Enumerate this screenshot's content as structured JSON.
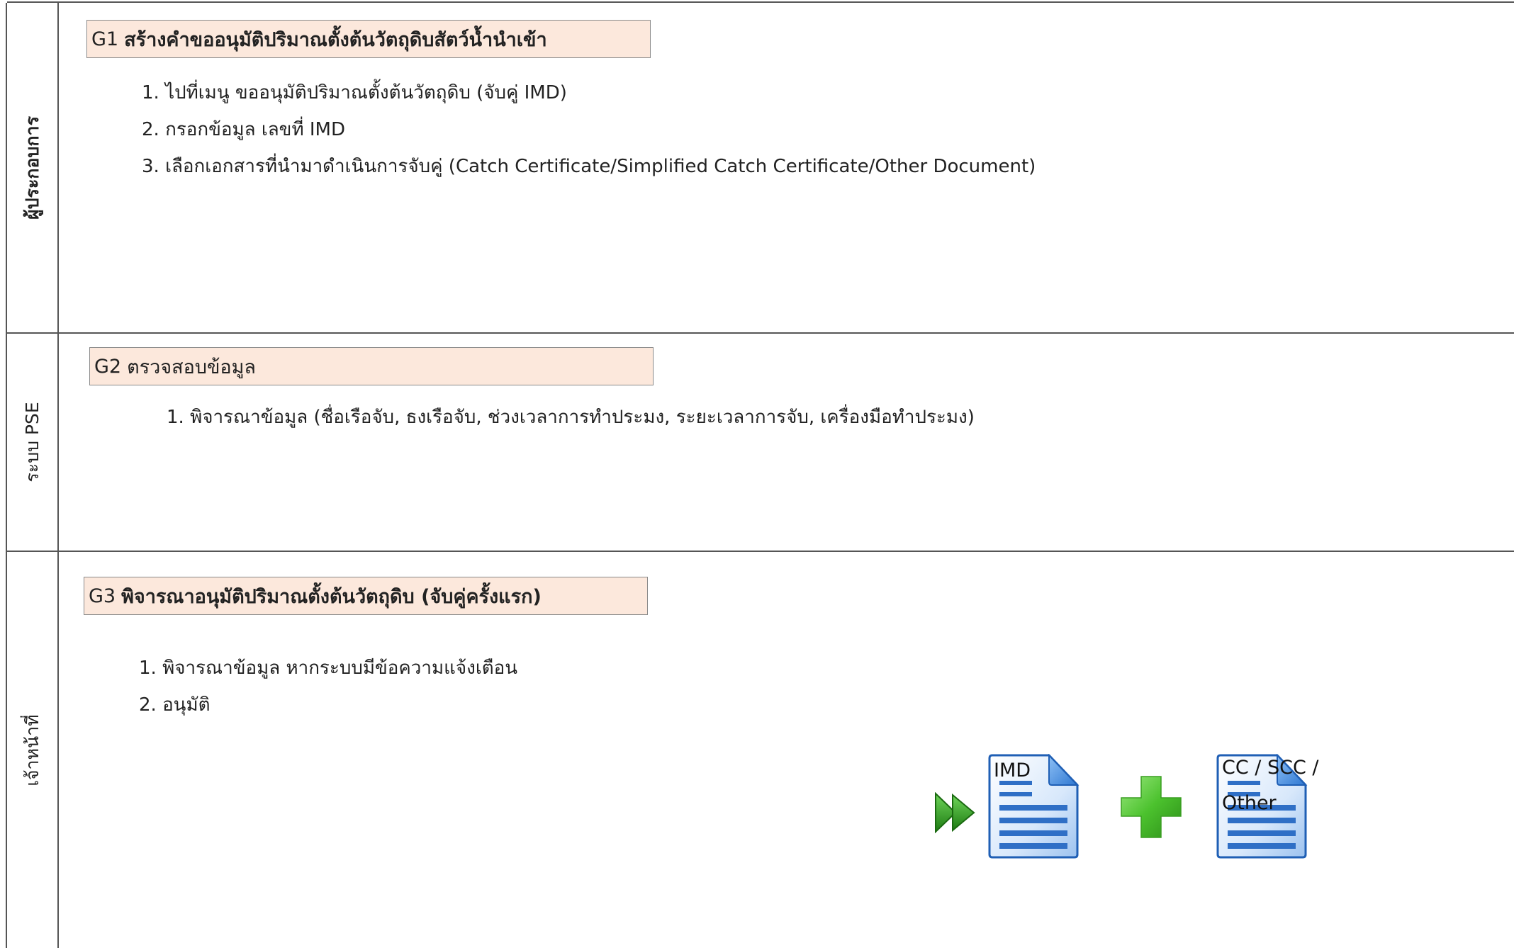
{
  "lanes": [
    {
      "label": "ผู้ประกอบการ"
    },
    {
      "label": "ระบบ PSE"
    },
    {
      "label": "เจ้าหน้าที่"
    }
  ],
  "steps": {
    "g1": {
      "code": "G1",
      "title": "สร้างคำขออนุมัติปริมาณตั้งต้นวัตถุดิบสัตว์น้ำนำเข้า",
      "items": [
        "1. ไปที่เมนู ขออนุมัติปริมาณตั้งต้นวัตถุดิบ (จับคู่ IMD)",
        "2. กรอกข้อมูล เลขที่ IMD",
        "3. เลือกเอกสารที่นำมาดำเนินการจับคู่  (Catch Certificate/Simplified Catch Certificate/Other Document)"
      ]
    },
    "g2": {
      "code": "G2",
      "title": "ตรวจสอบข้อมูล",
      "items": [
        "1. พิจารณาข้อมูล (ชื่อเรือจับ, ธงเรือจับ, ช่วงเวลาการทำประมง, ระยะเวลาการจับ, เครื่องมือทำประมง)"
      ]
    },
    "g3": {
      "code": "G3",
      "title": "พิจารณาอนุมัติปริมาณตั้งต้นวัตถุดิบ (จับคู่ครั้งแรก)",
      "items": [
        "1. พิจารณาข้อมูล หากระบบมีข้อความแจ้งเตือน",
        "2. อนุมัติ"
      ]
    }
  },
  "documents": {
    "imd_label": "IMD",
    "cc_label_line1": "CC / SCC /",
    "cc_label_line2": "Other"
  },
  "icons": {
    "arrow": "fast-forward-icon",
    "plus": "plus-icon",
    "doc": "document-icon"
  },
  "colors": {
    "step_fill": "#fce8dc",
    "arrow_green": "#2e9a1e",
    "plus_green": "#5cc93c",
    "doc_blue": "#1f5fb5"
  }
}
